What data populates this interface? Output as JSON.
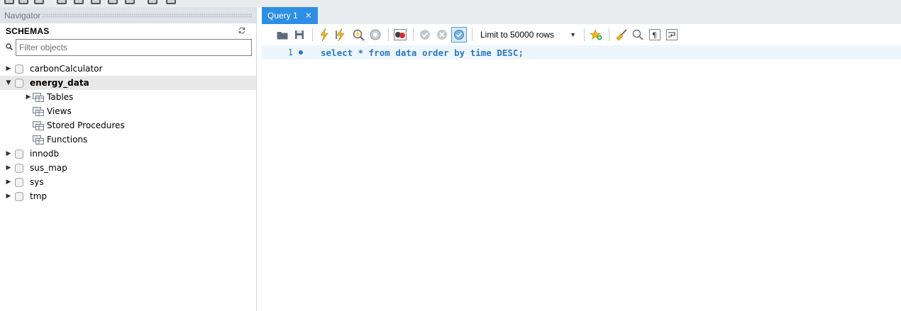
{
  "navigator": {
    "header": "Navigator",
    "schemas_title": "SCHEMAS",
    "filter_placeholder": "Filter objects",
    "schemas": [
      {
        "name": "carbonCalculator",
        "expanded": false
      },
      {
        "name": "energy_data",
        "expanded": true,
        "selected": true,
        "children": [
          "Tables",
          "Views",
          "Stored Procedures",
          "Functions"
        ]
      },
      {
        "name": "innodb",
        "expanded": false
      },
      {
        "name": "sus_map",
        "expanded": false
      },
      {
        "name": "sys",
        "expanded": false
      },
      {
        "name": "tmp",
        "expanded": false
      }
    ]
  },
  "editor": {
    "tab_label": "Query 1",
    "limit_label": "Limit to 50000 rows",
    "line_number": "1",
    "query": "select * from data order by time DESC;"
  },
  "colors": {
    "tab_active": "#2d8ee6",
    "code_text": "#2a79c4",
    "line_highlight": "#eef6fd"
  }
}
